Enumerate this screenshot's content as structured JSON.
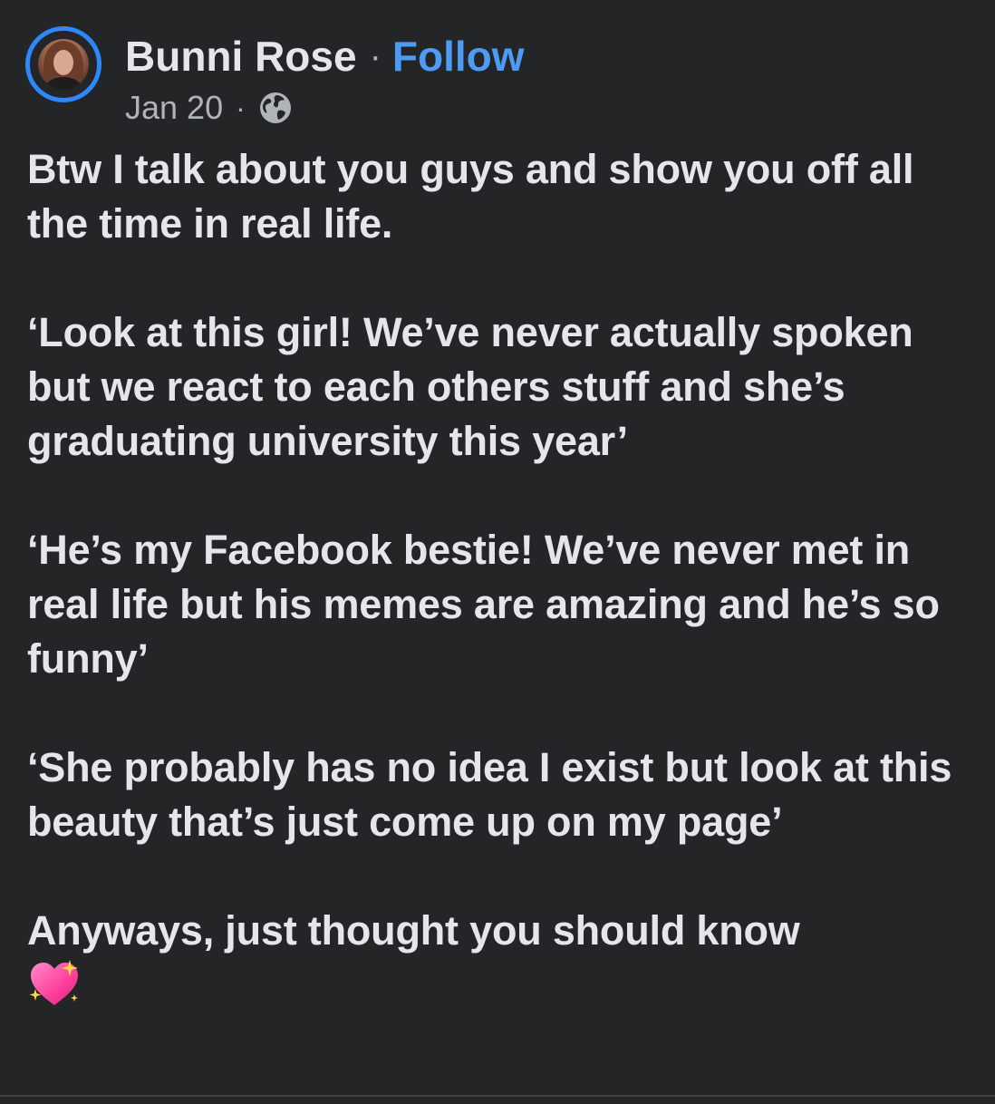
{
  "post": {
    "author_name": "Bunni Rose",
    "separator": "·",
    "follow_label": "Follow",
    "date": "Jan 20",
    "meta_separator": "·",
    "privacy_icon": "globe-icon",
    "paragraphs": [
      "Btw I talk about you guys and show you off all the time in real life.",
      "‘Look at this girl! We’ve never actually spoken but we react to each others stuff and she’s graduating university this year’",
      "‘He’s my Facebook bestie! We’ve never met in real life but his memes are amazing and he’s so funny’",
      "‘She probably has no idea I exist but look at this beauty that’s just come up on my page’",
      "Anyways, just thought you should know"
    ],
    "closing_emoji": "sparkling-heart-icon"
  },
  "colors": {
    "background": "#242526",
    "text": "#e4e6eb",
    "secondary_text": "#b0b3b8",
    "accent": "#4e9bf6",
    "avatar_ring": "#2d88ff",
    "heart_pink": "#ff4fa3",
    "sparkle": "#ffd54a"
  }
}
